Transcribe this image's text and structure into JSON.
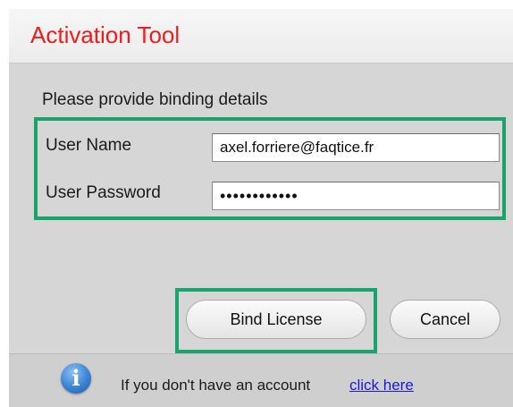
{
  "window": {
    "title": "Activation Tool",
    "title_color": "#ee1c1c"
  },
  "form": {
    "instructions": "Please provide binding details",
    "username_label": "User Name",
    "username_value": "axel.forriere@faqtice.fr",
    "password_label": "User Password",
    "password_value": "••••••••••••",
    "highlight_color": "#1aa36a"
  },
  "buttons": {
    "bind_label": "Bind License",
    "cancel_label": "Cancel"
  },
  "footer": {
    "icon": "info-icon",
    "text": "If you don't have an account",
    "link_text": "click here",
    "link_color": "#1a1ad6"
  }
}
